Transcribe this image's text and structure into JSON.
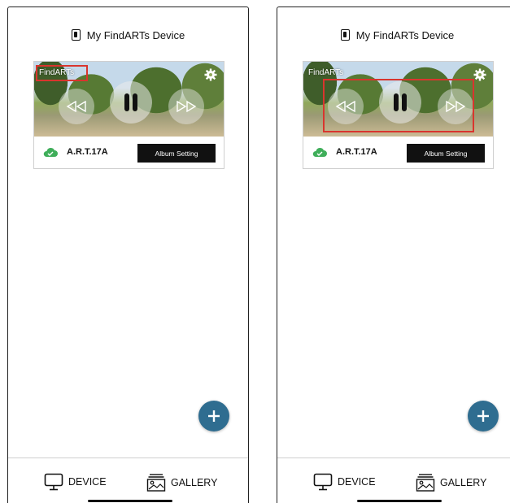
{
  "panels": [
    {
      "header_title": "My FindARTs Device",
      "art_label": "FindARTs",
      "device_name": "A.R.T.17A",
      "album_button": "Album Setting",
      "tabs": {
        "device": "DEVICE",
        "gallery": "GALLERY"
      },
      "highlight": "art-label"
    },
    {
      "header_title": "My FindARTs Device",
      "art_label": "FindARTs",
      "device_name": "A.R.T.17A",
      "album_button": "Album Setting",
      "tabs": {
        "device": "DEVICE",
        "gallery": "GALLERY"
      },
      "highlight": "playback-controls"
    }
  ],
  "colors": {
    "highlight": "#d9352e",
    "fab": "#2f6d90",
    "cloud": "#3fae5a",
    "button_bg": "#111111"
  },
  "icons": [
    "device-icon",
    "gear-icon",
    "rewind-icon",
    "pause-icon",
    "fast-forward-icon",
    "cloud-check-icon",
    "plus-icon",
    "monitor-icon",
    "gallery-icon"
  ]
}
